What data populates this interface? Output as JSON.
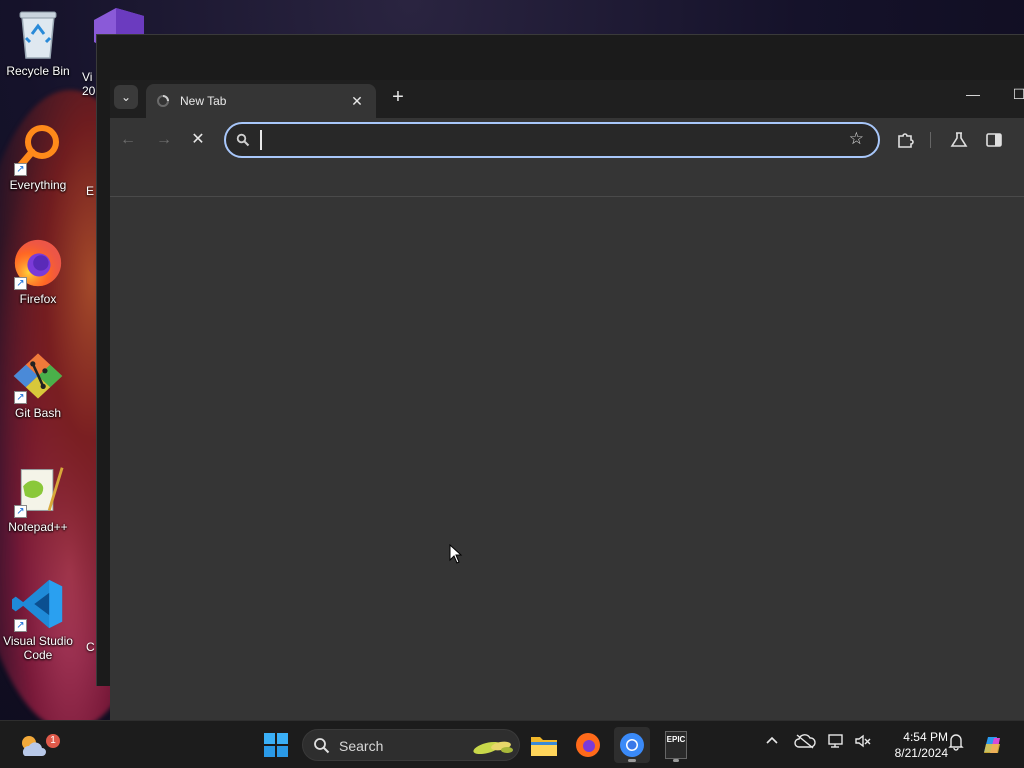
{
  "desktop": {
    "icons": [
      {
        "label": "Recycle Bin"
      },
      {
        "label": "Everything"
      },
      {
        "label": "Firefox"
      },
      {
        "label": "Git Bash"
      },
      {
        "label": "Notepad++"
      },
      {
        "label": "Visual Studio Code"
      }
    ],
    "partial_labels": {
      "visual_studio_top": "Vi",
      "visual_studio_bottom": "20",
      "everything_partial": "E",
      "vscode_partial": "C"
    }
  },
  "browser": {
    "tab": {
      "title": "New Tab",
      "close_glyph": "✕"
    },
    "new_tab_glyph": "+",
    "tab_search_glyph": "⌄",
    "window_controls": {
      "minimize": "—",
      "maximize": "☐"
    },
    "toolbar": {
      "back_glyph": "←",
      "forward_glyph": "→",
      "stop_glyph": "✕",
      "omnibox_value": "",
      "omnibox_placeholder": "",
      "bookmark_glyph": "☆"
    },
    "accent_color": "#a8c7fa"
  },
  "taskbar": {
    "search_label": "Search",
    "weather_badge": "1",
    "clock_time": "4:54 PM",
    "clock_date": "8/21/2024",
    "epic_label": "EPIC"
  }
}
